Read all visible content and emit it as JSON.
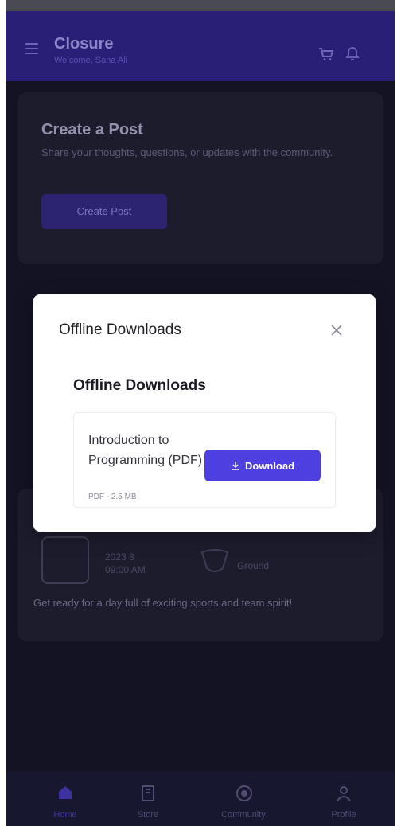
{
  "header": {
    "title": "Closure",
    "subtitle": "Welcome, Sana Ali"
  },
  "create_post": {
    "title": "Create a Post",
    "description": "Share your thoughts, questions, or updates with the community.",
    "button_label": "Create Post"
  },
  "event": {
    "date": "2023 8",
    "time": "09:00 AM",
    "location": "Ground",
    "description": "Get ready for a day full of exciting sports and team spirit!"
  },
  "modal": {
    "title": "Offline Downloads",
    "subtitle": "Offline Downloads",
    "item": {
      "name": "Introduction to Programming (PDF)",
      "meta": "PDF - 2.5 MB",
      "button_label": "Download"
    }
  },
  "nav": {
    "items": [
      {
        "label": "Home",
        "icon": "home-icon"
      },
      {
        "label": "Store",
        "icon": "store-icon"
      },
      {
        "label": "Community",
        "icon": "community-icon"
      },
      {
        "label": "Profile",
        "icon": "profile-icon"
      }
    ],
    "active": "Home"
  },
  "colors": {
    "accent": "#4d3fe0",
    "header_bg": "#2a1f77",
    "background": "#131324"
  }
}
